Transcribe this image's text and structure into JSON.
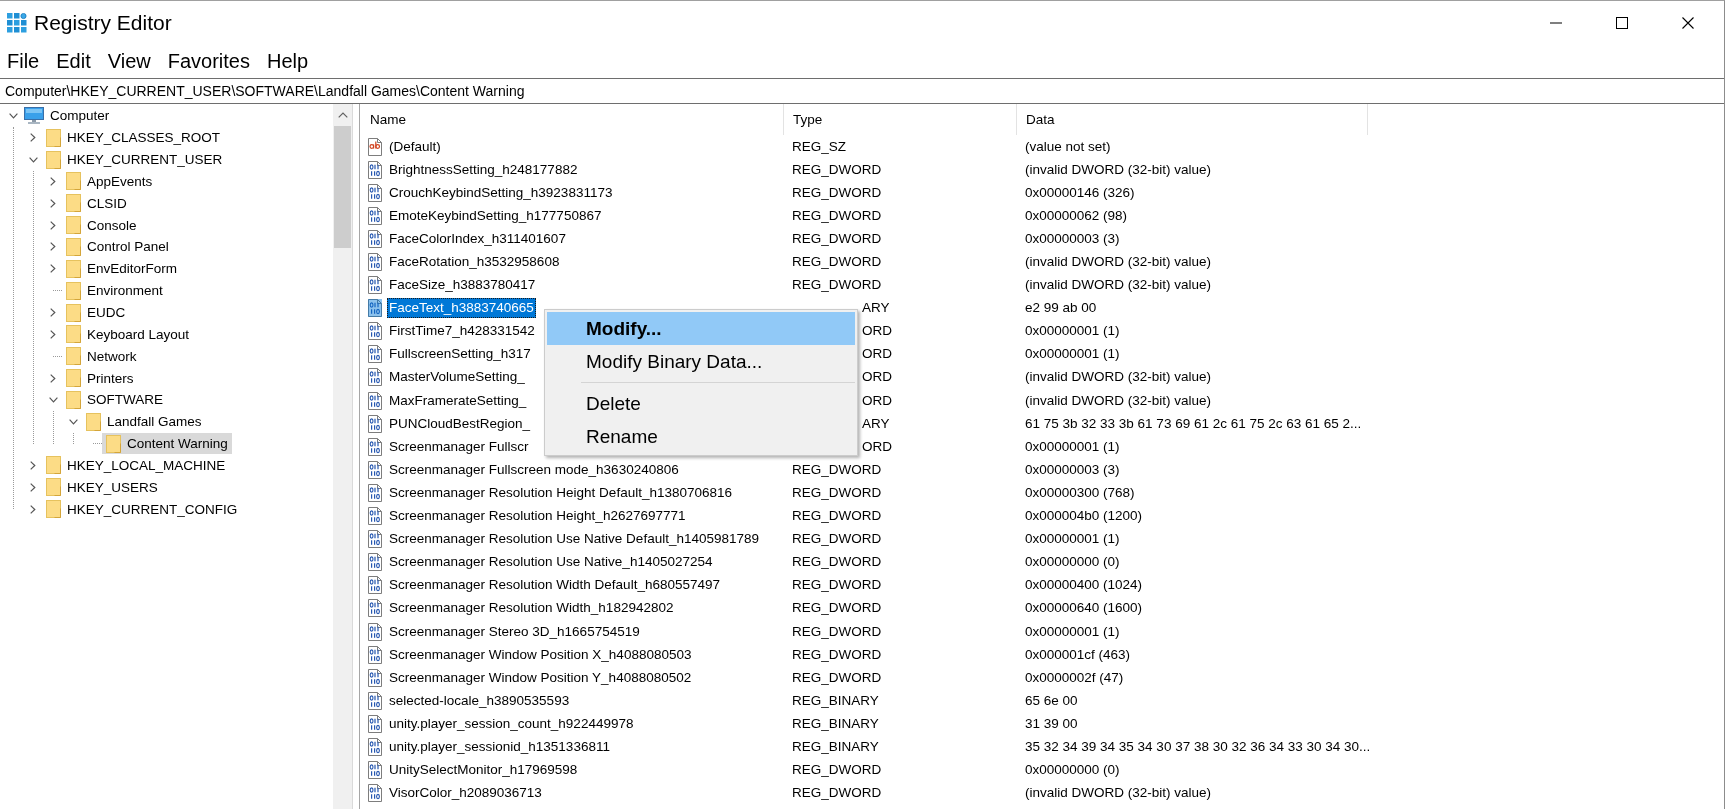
{
  "window": {
    "title": "Registry Editor"
  },
  "menu_bar": [
    "File",
    "Edit",
    "View",
    "Favorites",
    "Help"
  ],
  "address_bar": {
    "value": "Computer\\HKEY_CURRENT_USER\\SOFTWARE\\Landfall Games\\Content Warning"
  },
  "tree": [
    {
      "label": "Computer",
      "kind": "computer",
      "expanded": true,
      "selected": false,
      "children": [
        {
          "label": "HKEY_CLASSES_ROOT",
          "kind": "branch",
          "expanded": false,
          "selected": false
        },
        {
          "label": "HKEY_CURRENT_USER",
          "kind": "branch",
          "expanded": true,
          "selected": false,
          "children": [
            {
              "label": "AppEvents",
              "kind": "branch",
              "expanded": false,
              "selected": false
            },
            {
              "label": "CLSID",
              "kind": "branch",
              "expanded": false,
              "selected": false
            },
            {
              "label": "Console",
              "kind": "branch",
              "expanded": false,
              "selected": false
            },
            {
              "label": "Control Panel",
              "kind": "branch",
              "expanded": false,
              "selected": false
            },
            {
              "label": "EnvEditorForm",
              "kind": "branch",
              "expanded": false,
              "selected": false
            },
            {
              "label": "Environment",
              "kind": "leaf",
              "selected": false
            },
            {
              "label": "EUDC",
              "kind": "branch",
              "expanded": false,
              "selected": false
            },
            {
              "label": "Keyboard Layout",
              "kind": "branch",
              "expanded": false,
              "selected": false
            },
            {
              "label": "Network",
              "kind": "leaf",
              "selected": false
            },
            {
              "label": "Printers",
              "kind": "branch",
              "expanded": false,
              "selected": false
            },
            {
              "label": "SOFTWARE",
              "kind": "branch",
              "expanded": true,
              "selected": false,
              "children": [
                {
                  "label": "Landfall Games",
                  "kind": "branch",
                  "expanded": true,
                  "selected": false,
                  "children": [
                    {
                      "label": "Content Warning",
                      "kind": "leaf",
                      "selected": true
                    }
                  ]
                }
              ]
            }
          ]
        },
        {
          "label": "HKEY_LOCAL_MACHINE",
          "kind": "branch",
          "expanded": false,
          "selected": false
        },
        {
          "label": "HKEY_USERS",
          "kind": "branch",
          "expanded": false,
          "selected": false
        },
        {
          "label": "HKEY_CURRENT_CONFIG",
          "kind": "branch",
          "expanded": false,
          "selected": false
        }
      ]
    }
  ],
  "list": {
    "columns": [
      "Name",
      "Type",
      "Data"
    ],
    "rows": [
      {
        "name": "(Default)",
        "type": "REG_SZ",
        "data": "(value not set)",
        "kind": "string",
        "selected": false
      },
      {
        "name": "BrightnessSetting_h248177882",
        "type": "REG_DWORD",
        "data": "(invalid DWORD (32-bit) value)",
        "kind": "binary",
        "selected": false
      },
      {
        "name": "CrouchKeybindSetting_h3923831173",
        "type": "REG_DWORD",
        "data": "0x00000146 (326)",
        "kind": "binary",
        "selected": false
      },
      {
        "name": "EmoteKeybindSetting_h177750867",
        "type": "REG_DWORD",
        "data": "0x00000062 (98)",
        "kind": "binary",
        "selected": false
      },
      {
        "name": "FaceColorIndex_h311401607",
        "type": "REG_DWORD",
        "data": "0x00000003 (3)",
        "kind": "binary",
        "selected": false
      },
      {
        "name": "FaceRotation_h3532958608",
        "type": "REG_DWORD",
        "data": "(invalid DWORD (32-bit) value)",
        "kind": "binary",
        "selected": false
      },
      {
        "name": "FaceSize_h3883780417",
        "type": "REG_DWORD",
        "data": "(invalid DWORD (32-bit) value)",
        "kind": "binary",
        "selected": false
      },
      {
        "name": "FaceText_h3883740665",
        "type": "ARY",
        "data": "e2 99 ab 00",
        "kind": "binary",
        "selected": true
      },
      {
        "name": "FirstTime7_h428331542",
        "type": "ORD",
        "data": "0x00000001 (1)",
        "kind": "binary",
        "selected": false
      },
      {
        "name": "FullscreenSetting_h317",
        "type": "ORD",
        "data": "0x00000001 (1)",
        "kind": "binary",
        "selected": false
      },
      {
        "name": "MasterVolumeSetting_",
        "type": "ORD",
        "data": "(invalid DWORD (32-bit) value)",
        "kind": "binary",
        "selected": false
      },
      {
        "name": "MaxFramerateSetting_",
        "type": "ORD",
        "data": "(invalid DWORD (32-bit) value)",
        "kind": "binary",
        "selected": false
      },
      {
        "name": "PUNCloudBestRegion_",
        "type": "ARY",
        "data": "61 75 3b 32 33 3b 61 73 69 61 2c 61 75 2c 63 61 65 2...",
        "kind": "binary",
        "selected": false
      },
      {
        "name": "Screenmanager Fullscr",
        "type": "ORD",
        "data": "0x00000001 (1)",
        "kind": "binary",
        "selected": false
      },
      {
        "name": "Screenmanager Fullscreen mode_h3630240806",
        "type": "REG_DWORD",
        "data": "0x00000003 (3)",
        "kind": "binary",
        "selected": false
      },
      {
        "name": "Screenmanager Resolution Height Default_h1380706816",
        "type": "REG_DWORD",
        "data": "0x00000300 (768)",
        "kind": "binary",
        "selected": false
      },
      {
        "name": "Screenmanager Resolution Height_h2627697771",
        "type": "REG_DWORD",
        "data": "0x000004b0 (1200)",
        "kind": "binary",
        "selected": false
      },
      {
        "name": "Screenmanager Resolution Use Native Default_h1405981789",
        "type": "REG_DWORD",
        "data": "0x00000001 (1)",
        "kind": "binary",
        "selected": false
      },
      {
        "name": "Screenmanager Resolution Use Native_h1405027254",
        "type": "REG_DWORD",
        "data": "0x00000000 (0)",
        "kind": "binary",
        "selected": false
      },
      {
        "name": "Screenmanager Resolution Width Default_h680557497",
        "type": "REG_DWORD",
        "data": "0x00000400 (1024)",
        "kind": "binary",
        "selected": false
      },
      {
        "name": "Screenmanager Resolution Width_h182942802",
        "type": "REG_DWORD",
        "data": "0x00000640 (1600)",
        "kind": "binary",
        "selected": false
      },
      {
        "name": "Screenmanager Stereo 3D_h1665754519",
        "type": "REG_DWORD",
        "data": "0x00000001 (1)",
        "kind": "binary",
        "selected": false
      },
      {
        "name": "Screenmanager Window Position X_h4088080503",
        "type": "REG_DWORD",
        "data": "0x000001cf (463)",
        "kind": "binary",
        "selected": false
      },
      {
        "name": "Screenmanager Window Position Y_h4088080502",
        "type": "REG_DWORD",
        "data": "0x0000002f (47)",
        "kind": "binary",
        "selected": false
      },
      {
        "name": "selected-locale_h3890535593",
        "type": "REG_BINARY",
        "data": "65 6e 00",
        "kind": "binary",
        "selected": false
      },
      {
        "name": "unity.player_session_count_h922449978",
        "type": "REG_BINARY",
        "data": "31 39 00",
        "kind": "binary",
        "selected": false
      },
      {
        "name": "unity.player_sessionid_h1351336811",
        "type": "REG_BINARY",
        "data": "35 32 34 39 34 35 34 30 37 38 30 32 36 34 33 30 34 30...",
        "kind": "binary",
        "selected": false
      },
      {
        "name": "UnitySelectMonitor_h17969598",
        "type": "REG_DWORD",
        "data": "0x00000000 (0)",
        "kind": "binary",
        "selected": false
      },
      {
        "name": "VisorColor_h2089036713",
        "type": "REG_DWORD",
        "data": "(invalid DWORD (32-bit) value)",
        "kind": "binary",
        "selected": false
      }
    ]
  },
  "context_menu": {
    "groups": [
      [
        {
          "label": "Modify...",
          "default": true,
          "selected": true
        },
        {
          "label": "Modify Binary Data...",
          "default": false,
          "selected": false
        }
      ],
      [
        {
          "label": "Delete",
          "default": false,
          "selected": false
        },
        {
          "label": "Rename",
          "default": false,
          "selected": false
        }
      ]
    ]
  }
}
